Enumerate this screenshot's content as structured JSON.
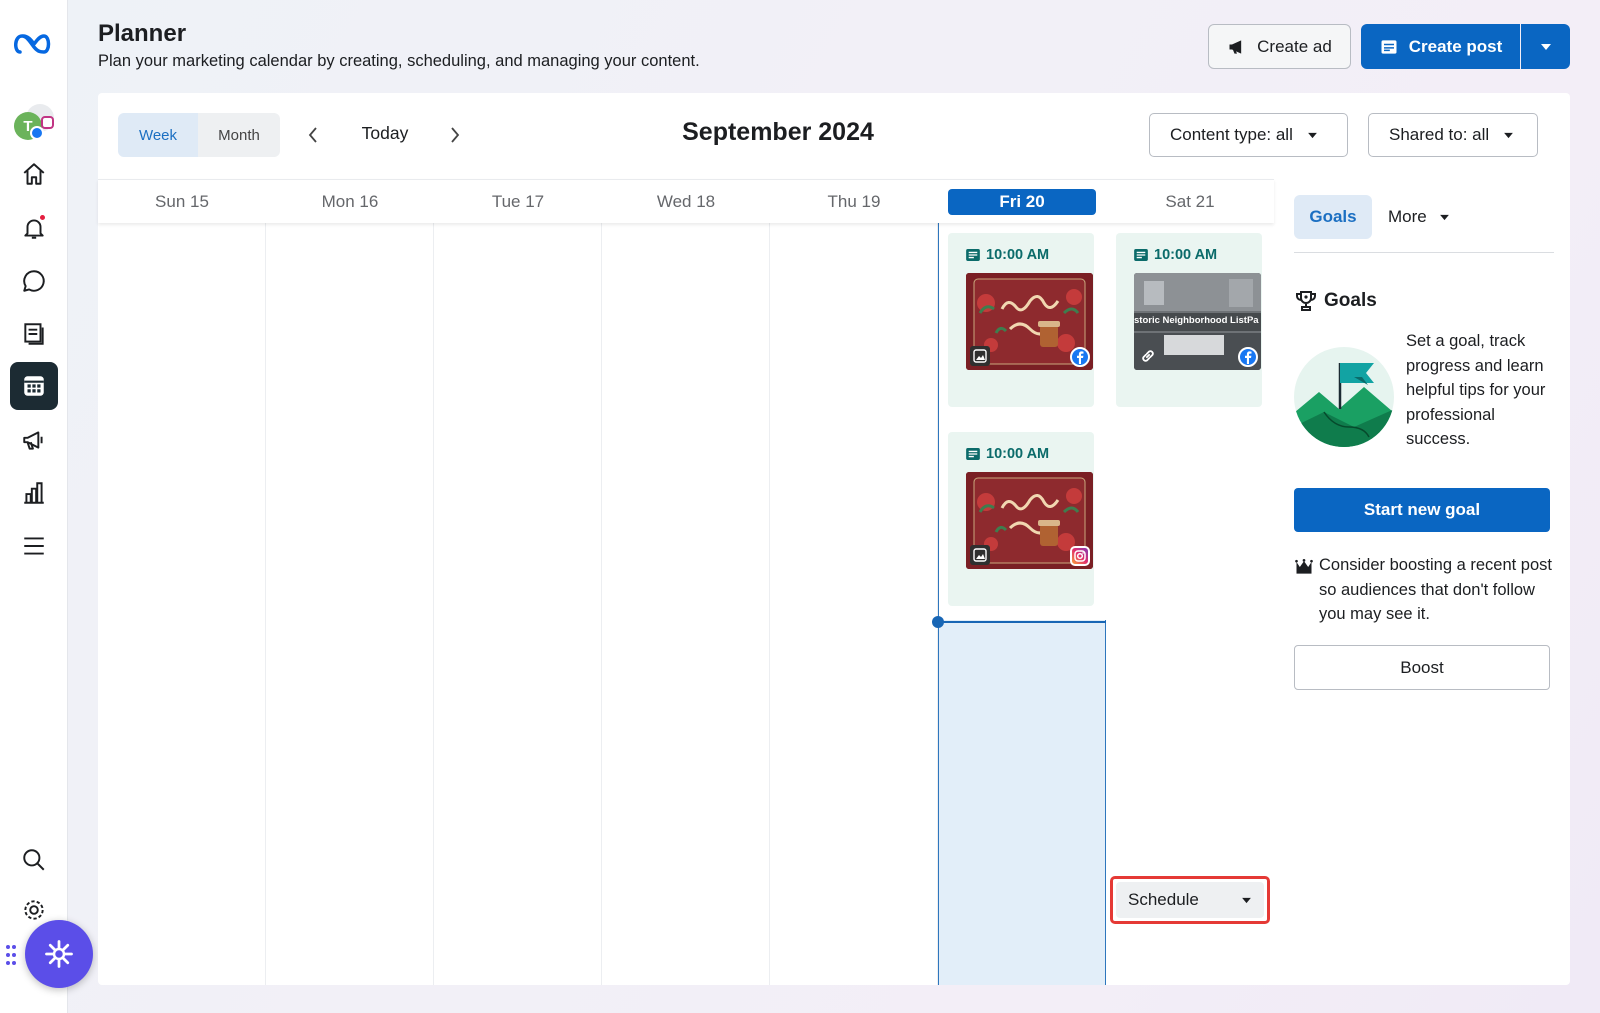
{
  "header": {
    "title": "Planner",
    "subtitle": "Plan your marketing calendar by creating, scheduling, and managing your content.",
    "create_ad_label": "Create ad",
    "create_post_label": "Create post"
  },
  "rail": {
    "items": [
      "meta-logo-icon",
      "account-avatar",
      "home-icon",
      "bell-icon",
      "chat-icon",
      "content-icon",
      "planner-icon",
      "ads-icon",
      "insights-icon",
      "menu-icon",
      "search-icon",
      "gear-icon"
    ],
    "active": "planner-icon"
  },
  "toolbar": {
    "view_week": "Week",
    "view_month": "Month",
    "active_view": "Week",
    "today_label": "Today",
    "month_title": "September 2024",
    "content_filter": "Content type: all",
    "shared_filter": "Shared to: all"
  },
  "days": [
    {
      "label": "Sun 15"
    },
    {
      "label": "Mon 16"
    },
    {
      "label": "Tue 17"
    },
    {
      "label": "Wed 18"
    },
    {
      "label": "Thu 19"
    },
    {
      "label": "Fri 20"
    },
    {
      "label": "Sat 21"
    }
  ],
  "posts": [
    {
      "day": "Fri 20",
      "time": "10:00 AM",
      "network": "facebook-icon",
      "type": "image-icon"
    },
    {
      "day": "Sat 21",
      "time": "10:00 AM",
      "network": "facebook-icon",
      "type": "link-icon",
      "thumb_text": "storic Neighborhood ListPa"
    },
    {
      "day": "Fri 20",
      "time": "10:00 AM",
      "network": "instagram-icon",
      "type": "image-icon"
    }
  ],
  "schedule_label": "Schedule",
  "side": {
    "tab_goals": "Goals",
    "tab_more": "More",
    "goals_heading": "Goals",
    "goals_text": "Set a goal, track progress and learn helpful tips for your professional success.",
    "start_goal_label": "Start new goal",
    "boost_tip": "Consider boosting a recent post so audiences that don't follow you may see it.",
    "boost_label": "Boost"
  },
  "colors": {
    "primary": "#0a66c2",
    "teal_accent": "#0b6b6a",
    "today_column": "#e2eef9",
    "highlight_border": "#e53935",
    "fab": "#5b4ee8"
  }
}
